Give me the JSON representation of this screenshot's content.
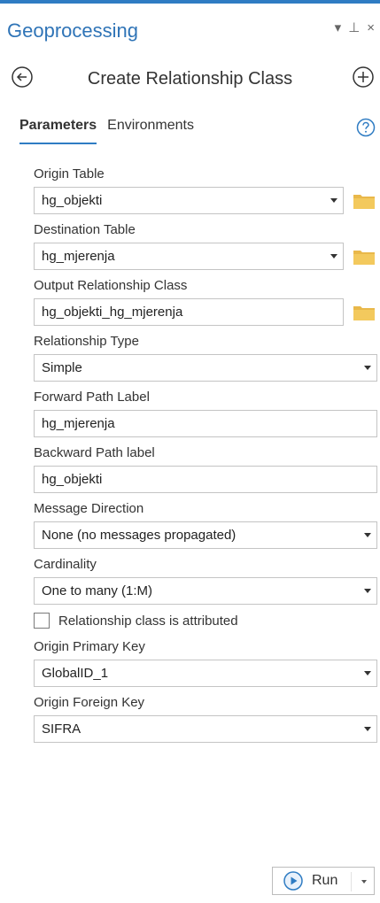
{
  "pane": {
    "title": "Geoprocessing",
    "controls": [
      "▾",
      "⊥",
      "×"
    ]
  },
  "tool": {
    "title": "Create Relationship Class"
  },
  "tabs": [
    {
      "label": "Parameters",
      "active": true
    },
    {
      "label": "Environments",
      "active": false
    }
  ],
  "params": {
    "origin_table": {
      "label": "Origin Table",
      "value": "hg_objekti"
    },
    "destination_table": {
      "label": "Destination Table",
      "value": "hg_mjerenja"
    },
    "output_rel_class": {
      "label": "Output Relationship Class",
      "value": "hg_objekti_hg_mjerenja"
    },
    "relationship_type": {
      "label": "Relationship Type",
      "value": "Simple"
    },
    "forward_path_label": {
      "label": "Forward Path Label",
      "value": "hg_mjerenja"
    },
    "backward_path_label": {
      "label": "Backward Path label",
      "value": "hg_objekti"
    },
    "message_direction": {
      "label": "Message Direction",
      "value": "None (no messages propagated)"
    },
    "cardinality": {
      "label": "Cardinality",
      "value": "One to many (1:M)"
    },
    "attributed": {
      "label": "Relationship class is attributed",
      "checked": false
    },
    "origin_primary_key": {
      "label": "Origin Primary Key",
      "value": "GlobalID_1"
    },
    "origin_foreign_key": {
      "label": "Origin Foreign Key",
      "value": "SIFRA"
    }
  },
  "run": {
    "label": "Run"
  },
  "colors": {
    "accent": "#2f7cc3",
    "title": "#2f74b7",
    "folder": "#f0c25a"
  }
}
